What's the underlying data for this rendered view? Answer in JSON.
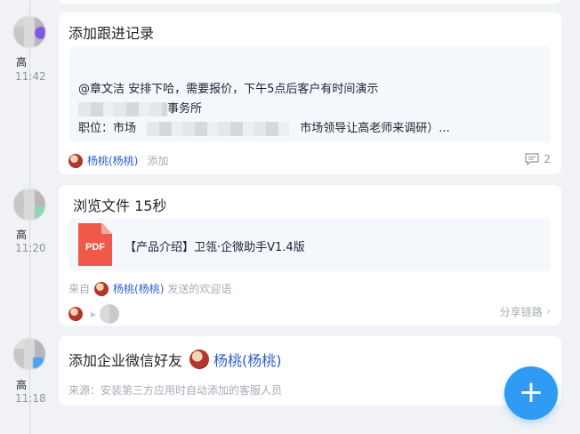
{
  "entries": [
    {
      "author": "高",
      "time": "11:42",
      "title": "添加跟进记录",
      "note_line1": "@章文洁 安排下哈，需要报价，下午5点后客户有时间演示",
      "note_line2_suffix": "事务所",
      "note_line3_prefix": "职位：市场",
      "note_line3_suffix": "市场领导让高老师来调研）...",
      "user": "杨桃(杨桃)",
      "action": "添加",
      "comment_count": "2"
    },
    {
      "author": "高",
      "time": "11:20",
      "title": "浏览文件 15秒",
      "file_icon_label": "PDF",
      "file_name": "【产品介绍】卫瓴·企微助手V1.4版",
      "from_prefix": "来自",
      "user": "杨桃(杨桃)",
      "from_suffix": "发送的欢迎语",
      "share_chain": "分享链路"
    },
    {
      "author": "高",
      "time": "11:18",
      "title": "添加企业微信好友",
      "user": "杨桃(杨桃)",
      "source": "来源：安装第三方应用时自动添加的客服人员"
    }
  ],
  "fab_label": "+",
  "colors": {
    "accent": "#2f9bf2",
    "link": "#2e5ecf",
    "pdf": "#f0584a",
    "background": "#f1f2f5"
  }
}
